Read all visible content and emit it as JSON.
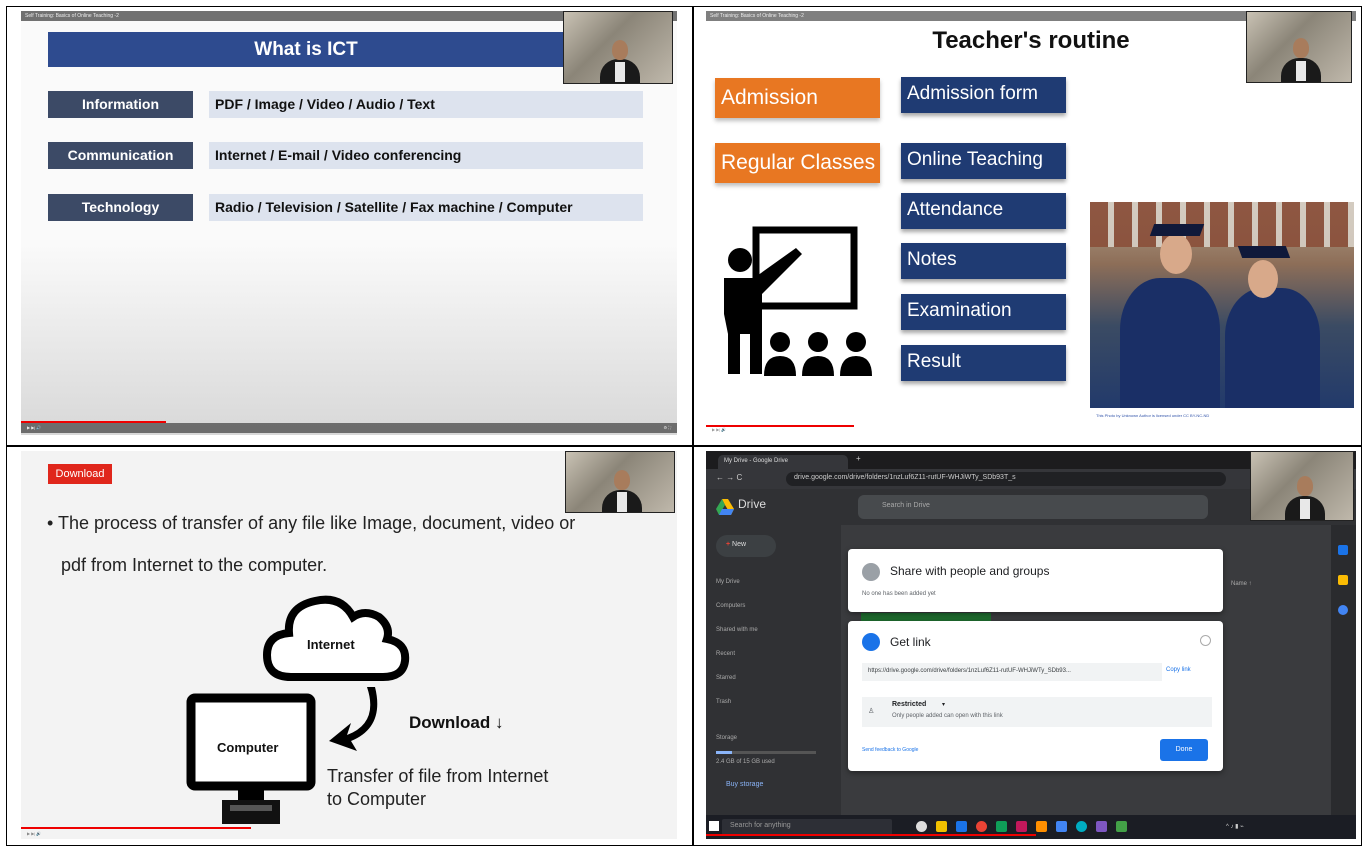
{
  "slide1": {
    "video_title": "Self Training: Basics of Online Teaching -2",
    "title": "What is ICT",
    "rows": [
      {
        "label": "Information",
        "value": "PDF / Image / Video / Audio / Text"
      },
      {
        "label": "Communication",
        "value": "Internet / E-mail / Video conferencing"
      },
      {
        "label": "Technology",
        "value": "Radio / Television / Satellite  / Fax machine / Computer"
      }
    ]
  },
  "slide2": {
    "video_title": "Self Training: Basics of Online Teaching -2",
    "title": "Teacher's routine",
    "left_items": [
      "Admission",
      "Regular Classes"
    ],
    "right_items": [
      "Admission form",
      "Online Teaching",
      "Attendance",
      "Notes",
      "Examination",
      "Result"
    ],
    "photo_credit": "This Photo by Unknown Author is licensed under CC BY-NC-ND"
  },
  "slide3": {
    "video_title": "Self Training: Basics of Online Teaching -2",
    "badge": "Download",
    "bullet_line1": "• The process of transfer of any file like Image, document, video or",
    "bullet_line2": "pdf from Internet to the computer.",
    "cloud_label": "Internet",
    "computer_label": "Computer",
    "download_label": "Download ↓",
    "caption_line1": "Transfer of file from Internet",
    "caption_line2": "to Computer"
  },
  "slide4": {
    "video_title": "Self Training: Basics of Online Teaching -2",
    "tab_title": "My Drive - Google Drive",
    "url": "drive.google.com/drive/folders/1nzLuf6Z11-rutUF-WHJiWTy_SDb93T_s",
    "app_name": "Drive",
    "search_placeholder": "Search in Drive",
    "new_button": "New",
    "sidebar": [
      "My Drive",
      "Computers",
      "Shared with me",
      "Recent",
      "Starred",
      "Trash",
      "Storage"
    ],
    "storage_text": "2.4 GB of 15 GB used",
    "buy_storage": "Buy storage",
    "column_name": "Name ↑",
    "share_title": "Share with people and groups",
    "share_sub": "No one has been added yet",
    "getlink_title": "Get link",
    "link_url": "https://drive.google.com/drive/folders/1nzLuf6Z11-rutUF-WHJiWTy_SDb93...",
    "copy_link": "Copy link",
    "restricted": "Restricted",
    "restricted_sub": "Only people added can open with this link",
    "feedback": "Send feedback to Google",
    "done": "Done",
    "taskbar_search": "Search for anything"
  },
  "colors": {
    "ict_title_bg": "#2e4b8f",
    "ict_label_bg": "#3c4a66",
    "ict_value_bg": "#dde3ee",
    "orange": "#e87722",
    "navy": "#1f3b73",
    "download_red": "#e0261b",
    "google_blue": "#1a73e8"
  }
}
